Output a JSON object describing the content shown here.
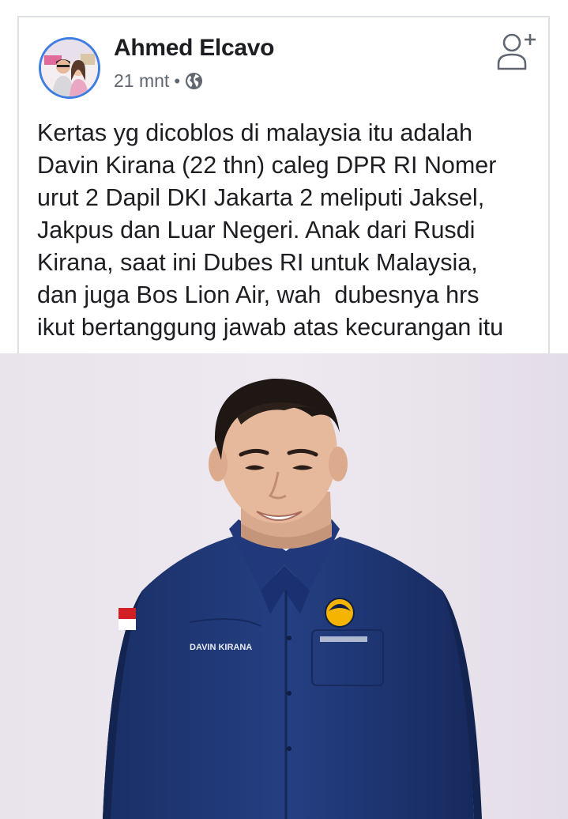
{
  "post": {
    "author_name": "Ahmed Elcavo",
    "time_ago": "21 mnt",
    "separator": "•",
    "privacy_icon": "globe-icon",
    "action_icon": "add-friend-icon",
    "text_lines": [
      "Kertas yg dicoblos di malaysia itu adalah",
      "Davin Kirana (22 thn) caleg DPR RI Nomer",
      "urut 2 Dapil DKI Jakarta 2 meliputi Jaksel,",
      "Jakpus dan Luar Negeri. Anak dari Rusdi",
      "Kirana, saat ini Dubes RI untuk Malaysia,",
      "dan juga Bos Lion Air, wah  dubesnya hrs",
      "ikut bertanggung jawab atas kecurangan itu"
    ],
    "photo": {
      "background_color": "#e8e2ea",
      "shirt_color": "#1f3a78",
      "shirt_name_tag": "DAVIN KIRANA",
      "flag_colors": [
        "#d21f26",
        "#ffffff"
      ]
    }
  },
  "colors": {
    "avatar_ring": "#3f7de0",
    "name_text": "#1c1e21",
    "meta_text": "#606770",
    "card_border": "#dcdfe4"
  }
}
